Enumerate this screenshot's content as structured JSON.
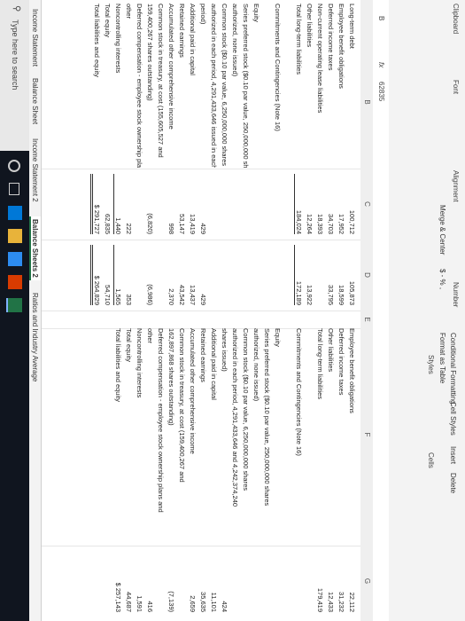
{
  "ribbon": {
    "clipboard": "Clipboard",
    "font": "Font",
    "alignment": "Alignment",
    "number": "Number",
    "styles": "Styles",
    "cells": "Cells",
    "merge_center": "Merge & Center",
    "number_format": "$ - % ,",
    "conditional_formatting": "Conditional Formatting",
    "format_as_table": "Format as Table",
    "cell_styles": "Cell Styles",
    "insert": "Insert",
    "delete": "Delete"
  },
  "formula_bar": {
    "cell_ref": "B",
    "fx": "fx",
    "value": "62835"
  },
  "columns": [
    "B",
    "C",
    "D",
    "E",
    "F",
    "G"
  ],
  "left_rows": [
    {
      "label": "Long-term debt",
      "c": "100,712",
      "d": "105,873"
    },
    {
      "label": "Employee benefit obligations",
      "c": "17,952",
      "d": "18,599"
    },
    {
      "label": "Deferred income taxes",
      "c": "34,703",
      "d": "33,795"
    },
    {
      "label": "Non-current operating lease liabilities",
      "c": "18,393",
      "d": ""
    },
    {
      "label": "Other liabilities",
      "c": "12,264",
      "d": "13,922"
    },
    {
      "label": "Total long-term liabilities",
      "c": "184,024",
      "d": "172,189"
    },
    {
      "label": "",
      "c": "",
      "d": ""
    },
    {
      "label": "Commitments and Contingencies (Note 16)",
      "c": "",
      "d": ""
    },
    {
      "label": "",
      "c": "",
      "d": ""
    },
    {
      "label": "Equity",
      "c": "",
      "d": ""
    },
    {
      "label": "Series preferred stock ($0.10 par value, 250,000,000 shares",
      "c": "",
      "d": ""
    },
    {
      "label": "authorized, none issued)",
      "c": "",
      "d": ""
    },
    {
      "label": "Common stock ($0.10 par value, 6,250,000,000 shares",
      "c": "",
      "d": ""
    },
    {
      "label": "authorized in each period, 4,291,433,646 issued in each",
      "c": "",
      "d": ""
    },
    {
      "label": "period)",
      "c": "429",
      "d": "429"
    },
    {
      "label": "Additional paid in capital",
      "c": "13,419",
      "d": "13,437"
    },
    {
      "label": "Retained earnings",
      "c": "53,147",
      "d": "43,542"
    },
    {
      "label": "Accumulated other comprehensive income",
      "c": "998",
      "d": "2,370"
    },
    {
      "label": "Common stock in treasury, at cost (155,605,527 and",
      "c": "",
      "d": ""
    },
    {
      "label": "159,400,267 shares outstanding)",
      "c": "(6,820)",
      "d": "(6,986)"
    },
    {
      "label": "Deferred compensation - employee stock ownership plans and",
      "c": "",
      "d": ""
    },
    {
      "label": "other",
      "c": "222",
      "d": "353"
    },
    {
      "label": "Noncontrolling interests",
      "c": "1,440",
      "d": "1,565"
    },
    {
      "label": "Total equity",
      "c": "62,835",
      "d": "54,710"
    },
    {
      "label": "Total liabilities and equity",
      "c": "$ 291,727",
      "d": "$ 264,829"
    }
  ],
  "right_rows": [
    {
      "label": "Employee benefit obligations",
      "g": "22,112"
    },
    {
      "label": "Deferred income taxes",
      "g": "31,232"
    },
    {
      "label": "Other liabilities",
      "g": "12,433"
    },
    {
      "label": "Total long-term liabilities",
      "g": "179,419"
    },
    {
      "label": "",
      "g": ""
    },
    {
      "label": "Commitments and Contingencies (Note 16)",
      "g": ""
    },
    {
      "label": "",
      "g": ""
    },
    {
      "label": "Equity",
      "g": ""
    },
    {
      "label": "Series preferred stock ($0.10 par value, 250,000,000 shares",
      "g": ""
    },
    {
      "label": "authorized, none issued)",
      "g": ""
    },
    {
      "label": "Common stock ($0.10 par value, 6,250,000,000 shares",
      "g": ""
    },
    {
      "label": "authorized in each period, 4,291,433,646 and 4,242,374,240",
      "g": ""
    },
    {
      "label": "shares issued)",
      "g": "424"
    },
    {
      "label": "Additional paid in capital",
      "g": "11,101"
    },
    {
      "label": "Retained earnings",
      "g": "35,635"
    },
    {
      "label": "Accumulated other comprehensive income",
      "g": "2,659"
    },
    {
      "label": "Common stock in treasury, at cost (159,400,267 and",
      "g": ""
    },
    {
      "label": "162,897,868 shares outstanding)",
      "g": "(7,139)"
    },
    {
      "label": "Deferred compensation - employee stock ownership plans and",
      "g": ""
    },
    {
      "label": "other",
      "g": "416"
    },
    {
      "label": "Noncontrolling interests",
      "g": "1,591"
    },
    {
      "label": "Total equity",
      "g": "44,687"
    },
    {
      "label": "Total liabilities and equity",
      "g": "$ 257,143"
    }
  ],
  "sheet_tabs": [
    "Income Statement",
    "Balance Sheet",
    "Income Statement 2",
    "Balance Sheets 2",
    "Ratios and Industry Average"
  ],
  "active_tab_index": 3,
  "taskbar": {
    "search_placeholder": "Type here to search"
  }
}
